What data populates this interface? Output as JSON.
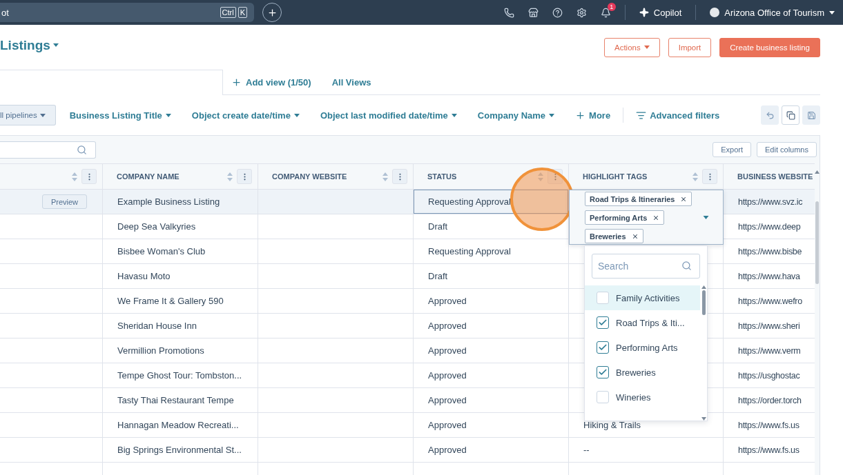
{
  "topbar": {
    "search_text": "ot",
    "shortcut_keys": [
      "Ctrl",
      "K"
    ],
    "notification_count": "1",
    "copilot": "Copilot",
    "account": "Arizona Office of Tourism"
  },
  "page": {
    "title": "Listings",
    "actions": [
      {
        "label": "Actions",
        "kind": "dropdown"
      },
      {
        "label": "Import",
        "kind": "outline"
      },
      {
        "label": "Create business listing",
        "kind": "primary"
      }
    ]
  },
  "view_tabs": {
    "add_view": "Add view (1/50)",
    "all_views": "All Views"
  },
  "filters": [
    {
      "label": "ll pipelines",
      "kind": "select"
    },
    {
      "label": "Business Listing Title",
      "kind": "dropdown"
    },
    {
      "label": "Object create date/time",
      "kind": "dropdown"
    },
    {
      "label": "Object last modified date/time",
      "kind": "dropdown"
    },
    {
      "label": "Company Name",
      "kind": "dropdown"
    },
    {
      "label": "More",
      "kind": "add"
    },
    {
      "label": "Advanced filters",
      "kind": "advanced"
    }
  ],
  "table": {
    "buttons": [
      "Export",
      "Edit columns"
    ],
    "columns": [
      "COMPANY NAME",
      "COMPANY WEBSITE",
      "STATUS",
      "HIGHLIGHT TAGS",
      "BUSINESS WEBSITE"
    ],
    "rows": [
      {
        "preview": "Preview",
        "company": "Example Business Listing",
        "status": "Requesting Approval",
        "url": "https://www.svz.ic",
        "selected": true,
        "status_focused": true
      },
      {
        "company": "Deep Sea Valkyries",
        "status": "Draft",
        "url": "https://www.deep",
        "selected": false,
        "status_focused": false
      },
      {
        "company": "Bisbee Woman's Club",
        "status": "Requesting Approval",
        "url": "https://www.bisbe",
        "selected": false,
        "status_focused": false
      },
      {
        "company": "Havasu Moto",
        "status": "Draft",
        "url": "https://www.hava",
        "selected": false,
        "status_focused": false
      },
      {
        "company": "We Frame It & Gallery 590",
        "status": "Approved",
        "url": "https://www.wefro",
        "selected": false,
        "status_focused": false
      },
      {
        "company": "Sheridan House Inn",
        "status": "Approved",
        "url": "https://www.sheri",
        "selected": false,
        "status_focused": false
      },
      {
        "company": "Vermillion Promotions",
        "status": "Approved",
        "url": "https://www.verm",
        "selected": false,
        "status_focused": false
      },
      {
        "company": "Tempe Ghost Tour: Tombston...",
        "status": "Approved",
        "url": "https://usghostac",
        "selected": false,
        "status_focused": false
      },
      {
        "company": "Tasty Thai Restaurant Tempe",
        "status": "Approved",
        "url": "https://order.torch",
        "selected": false,
        "status_focused": false
      },
      {
        "company": "Hannagan Meadow Recreati...",
        "status": "Approved",
        "tags": "Hiking & Trails",
        "url": "https://www.fs.us",
        "selected": false,
        "status_focused": false
      },
      {
        "company": "Big Springs Environmental St...",
        "status": "Approved",
        "tags": "--",
        "url": "https://www.fs.us",
        "selected": false,
        "status_focused": false
      },
      {
        "selected": false,
        "status_focused": false
      }
    ]
  },
  "tag_editor": {
    "tags": [
      "Road Trips & Itineraries",
      "Performing Arts",
      "Breweries"
    ],
    "search_placeholder": "Search",
    "options": [
      {
        "label": "Family Activities",
        "checked": false,
        "highlighted": true
      },
      {
        "label": "Road Trips & Iti...",
        "checked": true,
        "highlighted": false
      },
      {
        "label": "Performing Arts",
        "checked": true,
        "highlighted": false
      },
      {
        "label": "Breweries",
        "checked": true,
        "highlighted": false
      },
      {
        "label": "Wineries",
        "checked": false,
        "highlighted": false
      }
    ]
  }
}
